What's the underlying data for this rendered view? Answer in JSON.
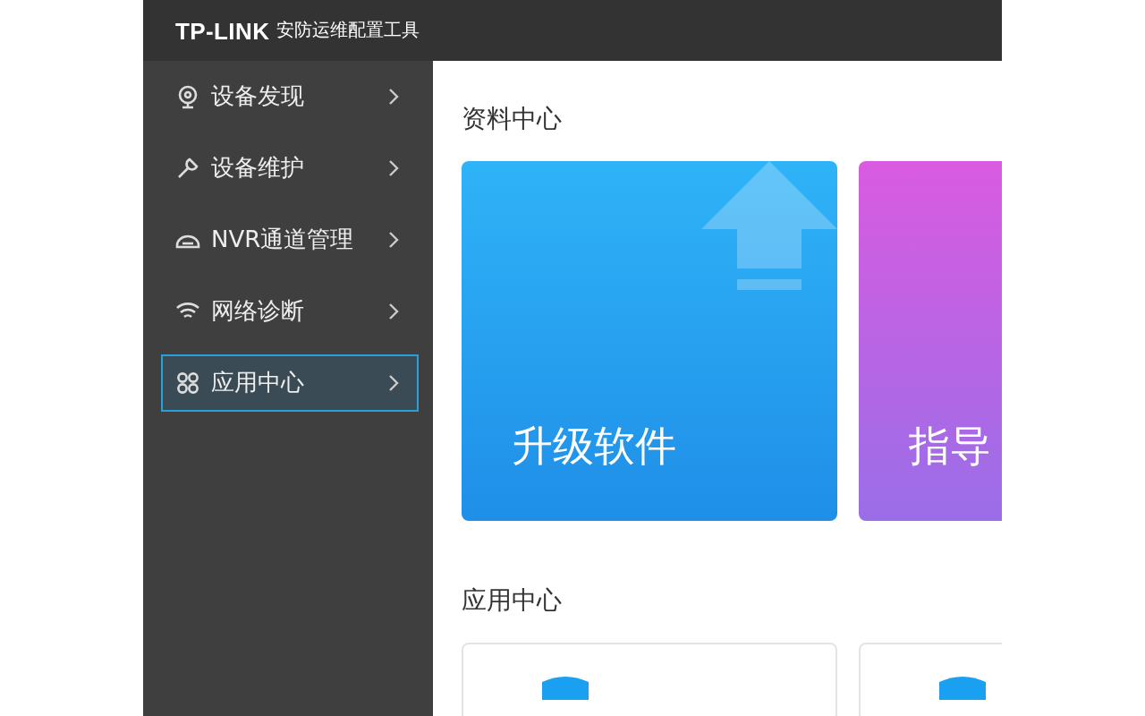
{
  "header": {
    "logo": "TP-LINK",
    "title": "安防运维配置工具"
  },
  "sidebar": {
    "items": [
      {
        "label": "设备发现",
        "kind": "discover",
        "selected": false
      },
      {
        "label": "设备维护",
        "kind": "maintain",
        "selected": false
      },
      {
        "label": "NVR通道管理",
        "kind": "nvr",
        "selected": false
      },
      {
        "label": "网络诊断",
        "kind": "network",
        "selected": false
      },
      {
        "label": "应用中心",
        "kind": "apps",
        "selected": true
      }
    ]
  },
  "resources": {
    "heading": "资料中心",
    "cards": [
      {
        "label": "升级软件",
        "kind": "upgrade"
      },
      {
        "label": "指导",
        "kind": "guide"
      }
    ]
  },
  "apps": {
    "heading": "应用中心",
    "cards": [
      {
        "kind": "app"
      },
      {
        "kind": "app"
      }
    ]
  }
}
